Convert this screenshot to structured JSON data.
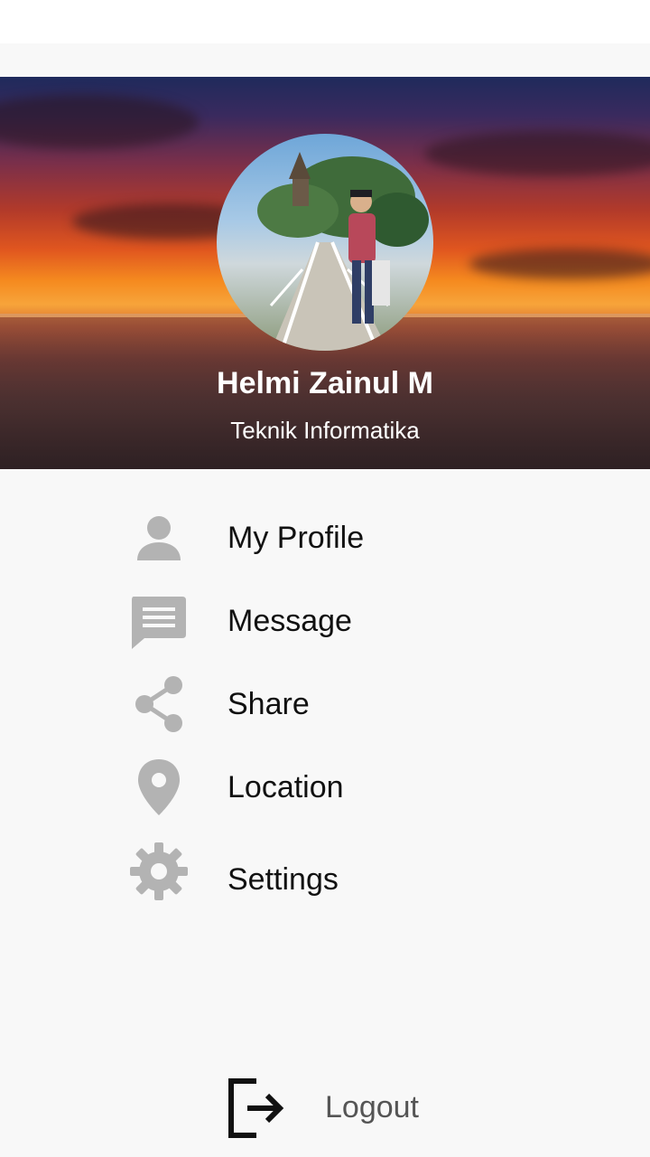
{
  "profile": {
    "name": "Helmi Zainul M",
    "subtitle": "Teknik Informatika"
  },
  "menu": [
    {
      "label": "My Profile",
      "icon": "person-icon"
    },
    {
      "label": "Message",
      "icon": "message-icon"
    },
    {
      "label": "Share",
      "icon": "share-icon"
    },
    {
      "label": "Location",
      "icon": "location-pin-icon"
    },
    {
      "label": "Settings",
      "icon": "gear-icon"
    }
  ],
  "logout": {
    "label": "Logout",
    "icon": "logout-icon"
  },
  "colors": {
    "icon_gray": "#b3b3b3",
    "background": "#f8f8f8",
    "text": "#111111",
    "logout_text": "#555555"
  }
}
